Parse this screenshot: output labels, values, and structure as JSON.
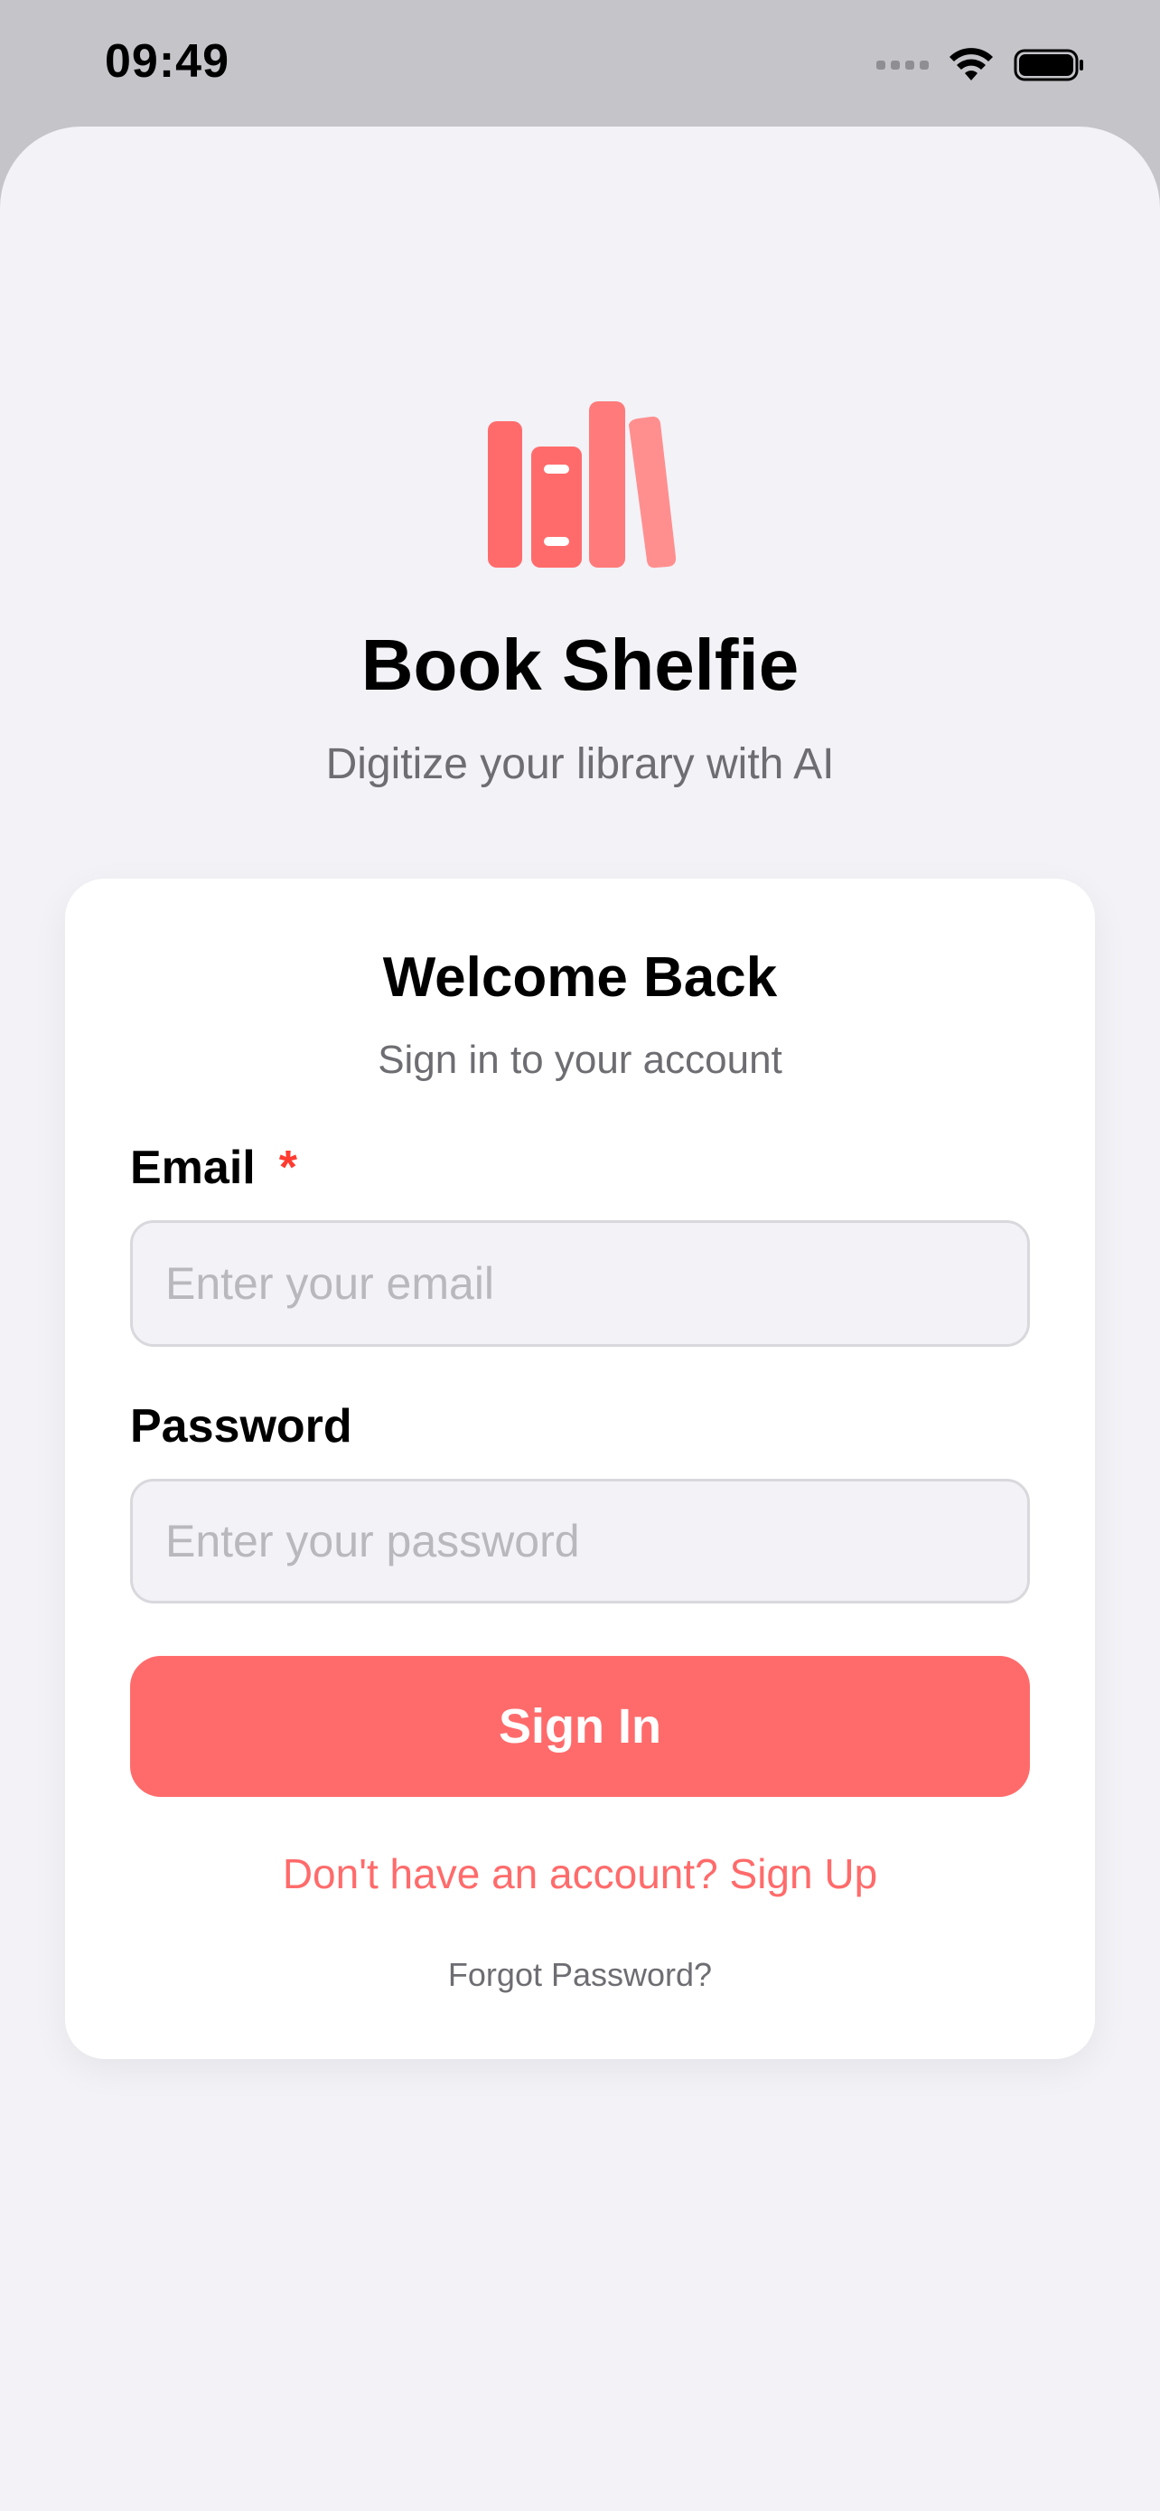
{
  "status_bar": {
    "time": "09:49"
  },
  "app": {
    "title": "Book Shelfie",
    "subtitle": "Digitize your library with AI",
    "accent_color": "#ff6b6b",
    "logo_icon": "books-icon"
  },
  "login_card": {
    "title": "Welcome Back",
    "subtitle": "Sign in to your account",
    "email": {
      "label": "Email",
      "required_marker": "*",
      "placeholder": "Enter your email",
      "value": ""
    },
    "password": {
      "label": "Password",
      "placeholder": "Enter your password",
      "value": ""
    },
    "submit_label": "Sign In",
    "signup_link": "Don't have an account? Sign Up",
    "forgot_link": "Forgot Password?"
  }
}
